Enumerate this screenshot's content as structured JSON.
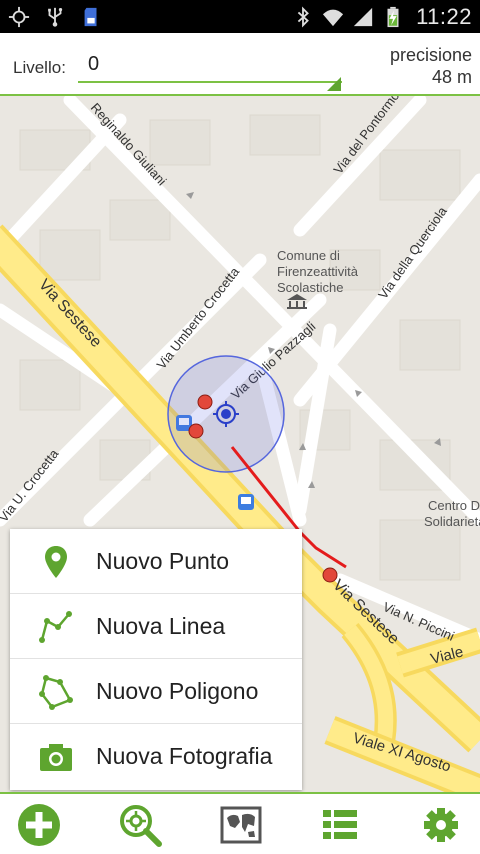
{
  "status_bar": {
    "time": "11:22",
    "icons": [
      "gps-icon",
      "usb-icon",
      "sd-card-icon",
      "bluetooth-icon",
      "wifi-icon",
      "signal-icon",
      "battery-charging-icon"
    ]
  },
  "level_bar": {
    "label": "Livello:",
    "value": "0",
    "precision_label": "precisione",
    "precision_value": "48 m"
  },
  "map": {
    "street_labels": [
      "Reginaldo Giuliani",
      "Via del Pontormo",
      "Via della Querciola",
      "Via Sestese",
      "Via Umberto Crocetta",
      "Via Giulio Pazzagli",
      "Via U. Crocetta",
      "Via Sestese",
      "Via N. Piccini",
      "Viale",
      "Viale XI Agosto"
    ],
    "poi_labels": {
      "comune_1": "Comune di",
      "comune_2": "Firenzeattività",
      "comune_3": "Scolastiche",
      "centro_1": "Centro D",
      "centro_2": "Solidarieta Q S"
    },
    "accuracy_circle_color": "#3f51d8",
    "route_color": "#e41c1c",
    "poi_color": "#e2473a"
  },
  "popup_menu": {
    "items": [
      {
        "label": "Nuovo Punto",
        "icon": "map-pin-icon"
      },
      {
        "label": "Nuova Linea",
        "icon": "polyline-icon"
      },
      {
        "label": "Nuovo Poligono",
        "icon": "polygon-icon"
      },
      {
        "label": "Nuova Fotografia",
        "icon": "camera-icon"
      }
    ]
  },
  "bottom_bar": {
    "buttons": [
      "add-icon",
      "search-location-icon",
      "map-icon",
      "list-icon",
      "settings-gear-icon"
    ]
  },
  "colors": {
    "accent": "#7cc144",
    "icon_green": "#5ea52f"
  }
}
